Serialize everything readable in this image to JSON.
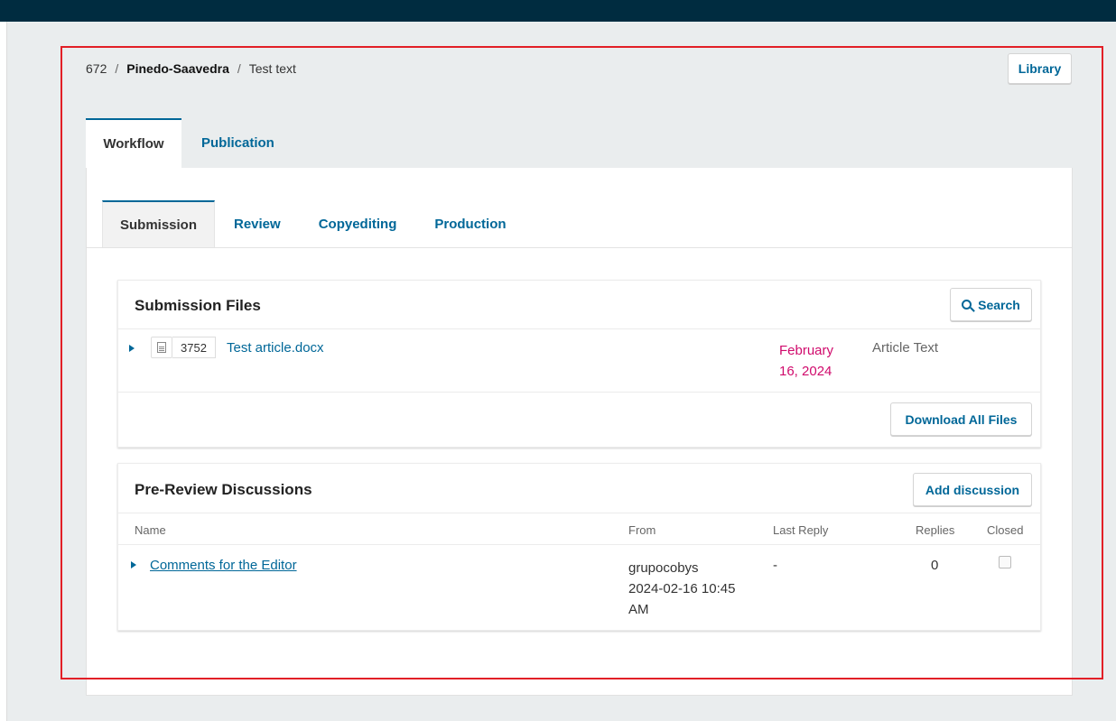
{
  "breadcrumb": {
    "id": "672",
    "author": "Pinedo-Saavedra",
    "title": "Test text",
    "separator": "/"
  },
  "header": {
    "library_label": "Library"
  },
  "main_tabs": [
    {
      "label": "Workflow",
      "active": true
    },
    {
      "label": "Publication",
      "active": false
    }
  ],
  "stage_tabs": [
    {
      "label": "Submission",
      "active": true
    },
    {
      "label": "Review",
      "active": false
    },
    {
      "label": "Copyediting",
      "active": false
    },
    {
      "label": "Production",
      "active": false
    }
  ],
  "submission_files": {
    "title": "Submission Files",
    "search_label": "Search",
    "download_label": "Download All Files",
    "files": [
      {
        "id": "3752",
        "name": "Test article.docx",
        "date_line1": "February",
        "date_line2": "16, 2024",
        "type": "Article Text"
      }
    ]
  },
  "discussions": {
    "title": "Pre-Review Discussions",
    "add_label": "Add discussion",
    "columns": {
      "name": "Name",
      "from": "From",
      "last_reply": "Last Reply",
      "replies": "Replies",
      "closed": "Closed"
    },
    "rows": [
      {
        "name": "Comments for the Editor",
        "from_line1": "grupocobys",
        "from_line2": "2024-02-16 10:45",
        "from_line3": "AM",
        "last_reply": "-",
        "replies": "0"
      }
    ]
  },
  "colors": {
    "topbar": "#002c40",
    "link": "#006798",
    "date": "#d00a6c",
    "highlight": "#e21f26"
  }
}
